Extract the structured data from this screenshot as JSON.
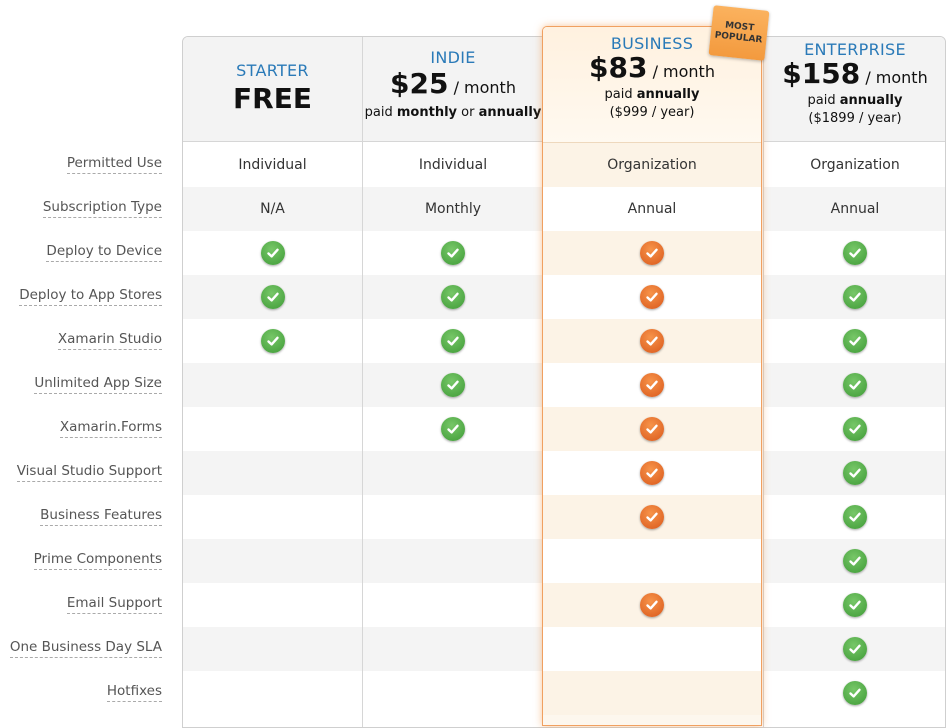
{
  "features": [
    "Permitted Use",
    "Subscription Type",
    "Deploy to Device",
    "Deploy to App Stores",
    "Xamarin Studio",
    "Unlimited App Size",
    "Xamarin.Forms",
    "Visual Studio Support",
    "Business Features",
    "Prime Components",
    "Email Support",
    "One Business Day SLA",
    "Hotfixes"
  ],
  "ribbon": {
    "line1": "MOST",
    "line2": "POPULAR"
  },
  "plans": {
    "starter": {
      "name": "STARTER",
      "price": "FREE",
      "permitted_use": "Individual",
      "subscription": "N/A"
    },
    "indie": {
      "name": "INDIE",
      "price": "$25",
      "per": "/ month",
      "paid": "paid",
      "billing_a": "monthly",
      "or": "or",
      "billing_b": "annually",
      "permitted_use": "Individual",
      "subscription": "Monthly"
    },
    "business": {
      "name": "BUSINESS",
      "price": "$83",
      "per": "/ month",
      "paid": "paid",
      "billing": "annually",
      "yearly": "($999 / year)",
      "permitted_use": "Organization",
      "subscription": "Annual"
    },
    "enterprise": {
      "name": "ENTERPRISE",
      "price": "$158",
      "per": "/ month",
      "paid": "paid",
      "billing": "annually",
      "yearly": "($1899 / year)",
      "permitted_use": "Organization",
      "subscription": "Annual"
    }
  },
  "included": {
    "starter": [
      true,
      true,
      true,
      false,
      false,
      false,
      false,
      false,
      false,
      false,
      false
    ],
    "indie": [
      true,
      true,
      true,
      true,
      true,
      false,
      false,
      false,
      false,
      false,
      false
    ],
    "business": [
      true,
      true,
      true,
      true,
      true,
      true,
      true,
      false,
      true,
      false,
      false
    ],
    "enterprise": [
      true,
      true,
      true,
      true,
      true,
      true,
      true,
      true,
      true,
      true,
      true
    ]
  },
  "colors": {
    "check_standard": "#4fa845",
    "check_featured": "#e8692a",
    "plan_name": "#2a7ab8",
    "featured_border": "#f0a060"
  }
}
